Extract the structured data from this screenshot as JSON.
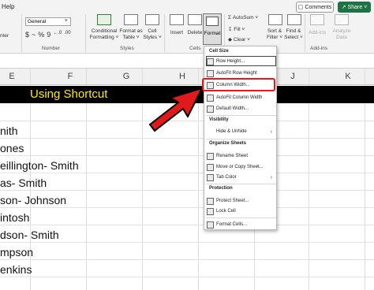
{
  "ribbon": {
    "help": "Help",
    "comments": "Comments",
    "share": "Share",
    "font_snip": "nter",
    "number_format": "General",
    "number_symbols": [
      "$",
      "~",
      "%",
      "9",
      "←.0",
      ".00"
    ],
    "groups": {
      "number": "Number",
      "styles": "Styles",
      "cells": "Cells",
      "addins": "Add-ins"
    },
    "buttons": {
      "conditional_formatting": "Conditional Formatting ˅",
      "format_as_table": "Format as Table ˅",
      "cell_styles": "Cell Styles ˅",
      "insert": "Insert",
      "delete": "Delete",
      "format": "Format",
      "autosum": "AutoSum ˅",
      "fill": "Fill ˅",
      "clear": "Clear ˅",
      "sort_filter": "Sort & Filter ˅",
      "find_select": "Find & Select ˅",
      "addins": "Add-ins",
      "analyze_data": "Analyze Data"
    }
  },
  "sheet": {
    "columns": [
      "E",
      "F",
      "G",
      "H",
      "I",
      "J",
      "K"
    ],
    "banner": "Using Shortcut",
    "names": [
      "nith",
      "ones",
      "eillington- Smith",
      "as- Smith",
      "son- Johnson",
      "intosh",
      "dson- Smith",
      "mpson",
      "enkins"
    ]
  },
  "menu": {
    "cell_size": "Cell Size",
    "row_height": "Row Height...",
    "autofit_row": "AutoFit Row Height",
    "column_width": "Column Width...",
    "autofit_column": "AutoFit Column Width",
    "default_width": "Default Width...",
    "visibility": "Visibility",
    "hide_unhide": "Hide & Unhide",
    "organize": "Organize Sheets",
    "rename": "Rename Sheet",
    "move_copy": "Move or Copy Sheet...",
    "tab_color": "Tab Color",
    "protection": "Protection",
    "protect_sheet": "Protect Sheet...",
    "lock_cell": "Lock Cell",
    "format_cells": "Format Cells...",
    "chevron": "›"
  },
  "colors": {
    "share_green": "#1f7244",
    "banner_yellow": "#ffeb00",
    "highlight_red": "#e21a1a"
  }
}
